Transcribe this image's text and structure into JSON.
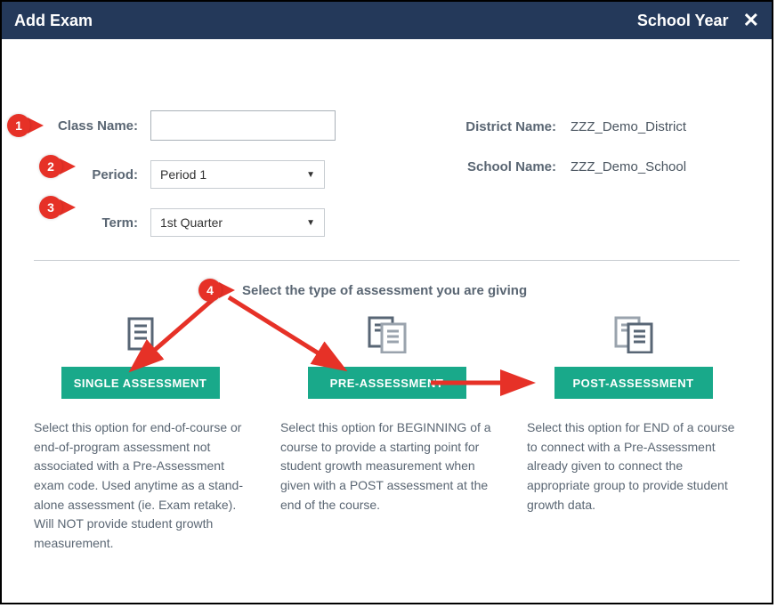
{
  "titlebar": {
    "title": "Add Exam",
    "right_label": "School Year",
    "close": "✕"
  },
  "form": {
    "class_name_label": "Class Name:",
    "class_name_value": "",
    "period_label": "Period:",
    "period_value": "Period 1",
    "term_label": "Term:",
    "term_value": "1st Quarter"
  },
  "info": {
    "district_label": "District Name:",
    "district_value": "ZZZ_Demo_District",
    "school_label": "School Name:",
    "school_value": "ZZZ_Demo_School"
  },
  "subheading": "Select the type of assessment you are giving",
  "assessments": {
    "single": {
      "button": "SINGLE ASSESSMENT",
      "desc": "Select this option for end-of-course or end-of-program assessment not associated with a Pre-Assessment exam code. Used anytime as a stand-alone assessment (ie. Exam retake). Will NOT provide student growth measurement."
    },
    "pre": {
      "button": "PRE-ASSESSMENT",
      "desc": "Select this option for BEGINNING of a course to provide a starting point for student growth measurement when given with a POST assessment at the end of the course."
    },
    "post": {
      "button": "POST-ASSESSMENT",
      "desc": "Select this option for END of a course to connect with a Pre-Assessment already given to connect the appropriate group to provide student growth data."
    }
  },
  "callouts": {
    "c1": "1",
    "c2": "2",
    "c3": "3",
    "c4": "4"
  }
}
